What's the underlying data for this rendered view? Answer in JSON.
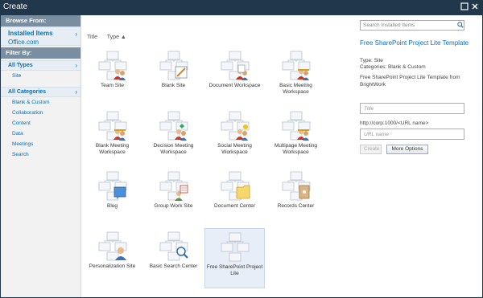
{
  "window": {
    "title": "Create"
  },
  "sidebar": {
    "browse_from_label": "Browse From:",
    "installed_items_label": "Installed Items",
    "office_label": "Office.com",
    "filter_by_label": "Filter By:",
    "all_types_label": "All Types",
    "types": [
      "Site"
    ],
    "all_categories_label": "All Categories",
    "categories": [
      "Blank & Custom",
      "Collaboration",
      "Content",
      "Data",
      "Meetings",
      "Search"
    ]
  },
  "sort": {
    "title_label": "Title",
    "type_label": "Type ▲"
  },
  "templates": [
    {
      "label": "Team Site",
      "icon": "team-site-icon"
    },
    {
      "label": "Blank Site",
      "icon": "blank-site-icon"
    },
    {
      "label": "Document Workspace",
      "icon": "document-workspace-icon"
    },
    {
      "label": "Basic Meeting Workspace",
      "icon": "basic-meeting-icon"
    },
    {
      "label": "Blank Meeting Workspace",
      "icon": "blank-meeting-icon"
    },
    {
      "label": "Decision Meeting Workspace",
      "icon": "decision-meeting-icon"
    },
    {
      "label": "Social Meeting Workspace",
      "icon": "social-meeting-icon"
    },
    {
      "label": "Multipage Meeting Workspace",
      "icon": "multipage-meeting-icon"
    },
    {
      "label": "Blog",
      "icon": "blog-icon"
    },
    {
      "label": "Group Work Site",
      "icon": "group-work-icon"
    },
    {
      "label": "Document Center",
      "icon": "document-center-icon"
    },
    {
      "label": "Records Center",
      "icon": "records-center-icon"
    },
    {
      "label": "Personalization Site",
      "icon": "personalization-icon"
    },
    {
      "label": "Basic Search Center",
      "icon": "search-center-icon"
    },
    {
      "label": "Free SharePoint Project Lite",
      "icon": "project-lite-icon"
    }
  ],
  "right_panel": {
    "search_placeholder": "Search Installed Items",
    "detail_title": "Free SharePoint Project Lite Template",
    "type_line": "Type: Site",
    "categories_line": "Categories: Blank & Custom",
    "description": "Free SharePoint Project Lite Template from BrightWork",
    "title_placeholder": "Title",
    "url_prefix": "http://corp:1000/<URL name>",
    "url_placeholder": "URL name",
    "create_label": "Create",
    "more_options_label": "More Options"
  },
  "colors": {
    "titlebar": "#21374c",
    "link": "#0072bc",
    "section_header": "#7a8ea2",
    "selected_tile": "#e7eef7"
  }
}
